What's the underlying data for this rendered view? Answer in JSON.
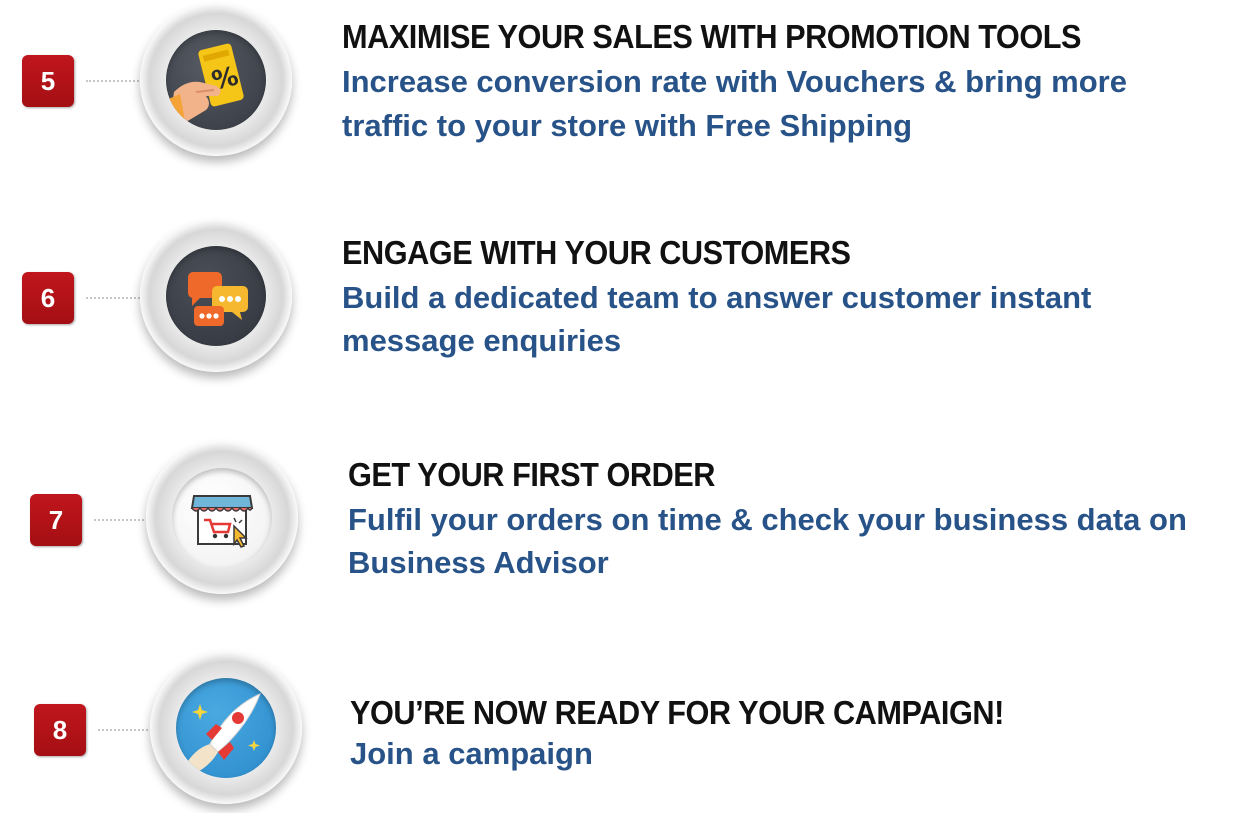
{
  "steps": [
    {
      "number": "5",
      "icon": "promotion-voucher-icon",
      "title": "MAXIMISE YOUR SALES WITH PROMOTION TOOLS",
      "description_lines": [
        "Increase conversion rate with Vouchers & bring more",
        "traffic to your store with Free Shipping"
      ]
    },
    {
      "number": "6",
      "icon": "chat-bubbles-icon",
      "title": "ENGAGE WITH YOUR CUSTOMERS",
      "description_lines": [
        "Build a dedicated team to answer customer instant",
        "message enquiries"
      ]
    },
    {
      "number": "7",
      "icon": "online-store-icon",
      "title": "GET YOUR FIRST ORDER",
      "description_lines": [
        "Fulfil your orders on time & check your business data on",
        "Business Advisor"
      ]
    },
    {
      "number": "8",
      "icon": "rocket-launch-icon",
      "title": "YOU’RE NOW READY FOR YOUR CAMPAIGN!",
      "description_lines": [
        "Join a campaign"
      ]
    }
  ],
  "colors": {
    "badge": "#b5121b",
    "title": "#111111",
    "description": "#285388"
  }
}
